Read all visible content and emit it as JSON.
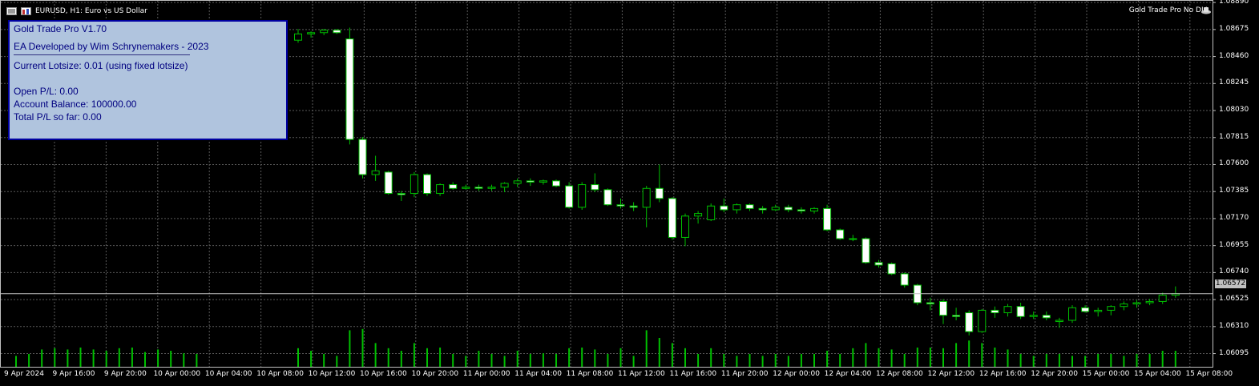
{
  "header": {
    "symbol_title": "EURUSD, H1:  Euro vs US Dollar",
    "ea_name": "Gold Trade Pro No DLL"
  },
  "panel": {
    "line1": "Gold Trade Pro V1.70",
    "line2": "EA Developed by Wim Schrynemakers - 2023",
    "line3": "Current Lotsize: 0.01 (using fixed lotsize)",
    "line4": "Open P/L: 0.00",
    "line5": "Account Balance: 100000.00",
    "line6": "Total P/L so far: 0.00"
  },
  "colors": {
    "background": "#000000",
    "grid": "#5a5a5a",
    "bull_body": "#000000",
    "bear_body": "#ffffff",
    "wick": "#00c000",
    "volume": "#00c000",
    "panel_bg": "#b0c4de",
    "panel_border": "#0000a0",
    "panel_text": "#000080",
    "bid_line": "#c0c0c0"
  },
  "chart_data": {
    "type": "candlestick",
    "symbol": "EURUSD",
    "timeframe": "H1",
    "ylim": [
      1.0599,
      1.0891
    ],
    "price_ticks": [
      "1.08890",
      "1.08675",
      "1.08460",
      "1.08245",
      "1.08030",
      "1.07815",
      "1.07600",
      "1.07385",
      "1.07170",
      "1.06955",
      "1.06740",
      "1.06525",
      "1.06310",
      "1.06095"
    ],
    "time_ticks": [
      "9 Apr 2024",
      "9 Apr 16:00",
      "9 Apr 20:00",
      "10 Apr 00:00",
      "10 Apr 04:00",
      "10 Apr 08:00",
      "10 Apr 12:00",
      "10 Apr 16:00",
      "10 Apr 20:00",
      "11 Apr 00:00",
      "11 Apr 04:00",
      "11 Apr 08:00",
      "11 Apr 12:00",
      "11 Apr 16:00",
      "11 Apr 20:00",
      "12 Apr 00:00",
      "12 Apr 04:00",
      "12 Apr 08:00",
      "12 Apr 12:00",
      "12 Apr 16:00",
      "12 Apr 20:00",
      "15 Apr 00:00",
      "15 Apr 04:00",
      "15 Apr 08:00"
    ],
    "bid_price": "1.06572",
    "grid": true,
    "candles": [
      {
        "o": 1.0859,
        "h": 1.0868,
        "l": 1.0857,
        "c": 1.0864
      },
      {
        "o": 1.0864,
        "h": 1.0866,
        "l": 1.0861,
        "c": 1.0865
      },
      {
        "o": 1.0865,
        "h": 1.0868,
        "l": 1.0863,
        "c": 1.0867
      },
      {
        "o": 1.0867,
        "h": 1.0868,
        "l": 1.0864,
        "c": 1.0865
      },
      {
        "o": 1.086,
        "h": 1.0869,
        "l": 1.0776,
        "c": 1.078
      },
      {
        "o": 1.078,
        "h": 1.0782,
        "l": 1.0749,
        "c": 1.0752
      },
      {
        "o": 1.0752,
        "h": 1.0767,
        "l": 1.0747,
        "c": 1.0755
      },
      {
        "o": 1.0754,
        "h": 1.0755,
        "l": 1.0736,
        "c": 1.0737
      },
      {
        "o": 1.0737,
        "h": 1.0739,
        "l": 1.0731,
        "c": 1.0736
      },
      {
        "o": 1.0737,
        "h": 1.0754,
        "l": 1.0734,
        "c": 1.0752
      },
      {
        "o": 1.0752,
        "h": 1.0753,
        "l": 1.0735,
        "c": 1.0737
      },
      {
        "o": 1.0737,
        "h": 1.0745,
        "l": 1.0735,
        "c": 1.0744
      },
      {
        "o": 1.0744,
        "h": 1.0746,
        "l": 1.074,
        "c": 1.0741
      },
      {
        "o": 1.0741,
        "h": 1.0744,
        "l": 1.074,
        "c": 1.0742
      },
      {
        "o": 1.0742,
        "h": 1.0744,
        "l": 1.0739,
        "c": 1.0741
      },
      {
        "o": 1.0741,
        "h": 1.0744,
        "l": 1.0739,
        "c": 1.0742
      },
      {
        "o": 1.0742,
        "h": 1.0746,
        "l": 1.0738,
        "c": 1.0745
      },
      {
        "o": 1.0745,
        "h": 1.0749,
        "l": 1.0742,
        "c": 1.0747
      },
      {
        "o": 1.0747,
        "h": 1.0749,
        "l": 1.0743,
        "c": 1.0746
      },
      {
        "o": 1.0746,
        "h": 1.0748,
        "l": 1.0744,
        "c": 1.0747
      },
      {
        "o": 1.0747,
        "h": 1.0748,
        "l": 1.0742,
        "c": 1.0743
      },
      {
        "o": 1.0743,
        "h": 1.0746,
        "l": 1.0725,
        "c": 1.0726
      },
      {
        "o": 1.0726,
        "h": 1.0746,
        "l": 1.0724,
        "c": 1.0744
      },
      {
        "o": 1.0744,
        "h": 1.0753,
        "l": 1.0738,
        "c": 1.074
      },
      {
        "o": 1.074,
        "h": 1.0741,
        "l": 1.0727,
        "c": 1.0728
      },
      {
        "o": 1.0728,
        "h": 1.0733,
        "l": 1.0725,
        "c": 1.0727
      },
      {
        "o": 1.0727,
        "h": 1.073,
        "l": 1.0723,
        "c": 1.0726
      },
      {
        "o": 1.0726,
        "h": 1.0743,
        "l": 1.071,
        "c": 1.0741
      },
      {
        "o": 1.0741,
        "h": 1.076,
        "l": 1.073,
        "c": 1.0733
      },
      {
        "o": 1.0733,
        "h": 1.0734,
        "l": 1.07,
        "c": 1.0702
      },
      {
        "o": 1.0702,
        "h": 1.0721,
        "l": 1.0695,
        "c": 1.0719
      },
      {
        "o": 1.0719,
        "h": 1.0723,
        "l": 1.0713,
        "c": 1.0721
      },
      {
        "o": 1.0716,
        "h": 1.0729,
        "l": 1.0715,
        "c": 1.0727
      },
      {
        "o": 1.0727,
        "h": 1.0733,
        "l": 1.0722,
        "c": 1.0724
      },
      {
        "o": 1.0724,
        "h": 1.0729,
        "l": 1.0721,
        "c": 1.0728
      },
      {
        "o": 1.0728,
        "h": 1.0729,
        "l": 1.0723,
        "c": 1.0725
      },
      {
        "o": 1.0725,
        "h": 1.0727,
        "l": 1.0721,
        "c": 1.0724
      },
      {
        "o": 1.0724,
        "h": 1.0728,
        "l": 1.0723,
        "c": 1.0726
      },
      {
        "o": 1.0726,
        "h": 1.0728,
        "l": 1.0722,
        "c": 1.0724
      },
      {
        "o": 1.0724,
        "h": 1.0726,
        "l": 1.0721,
        "c": 1.0723
      },
      {
        "o": 1.0723,
        "h": 1.0726,
        "l": 1.0721,
        "c": 1.0725
      },
      {
        "o": 1.0725,
        "h": 1.0728,
        "l": 1.0707,
        "c": 1.0708
      },
      {
        "o": 1.0708,
        "h": 1.0709,
        "l": 1.07,
        "c": 1.0701
      },
      {
        "o": 1.0701,
        "h": 1.0704,
        "l": 1.0699,
        "c": 1.0701
      },
      {
        "o": 1.0701,
        "h": 1.0702,
        "l": 1.0681,
        "c": 1.0682
      },
      {
        "o": 1.0682,
        "h": 1.0684,
        "l": 1.0678,
        "c": 1.068
      },
      {
        "o": 1.0681,
        "h": 1.0682,
        "l": 1.0672,
        "c": 1.0673
      },
      {
        "o": 1.0673,
        "h": 1.0674,
        "l": 1.0662,
        "c": 1.0664
      },
      {
        "o": 1.0664,
        "h": 1.0665,
        "l": 1.0648,
        "c": 1.065
      },
      {
        "o": 1.065,
        "h": 1.0654,
        "l": 1.0644,
        "c": 1.0649
      },
      {
        "o": 1.0651,
        "h": 1.0653,
        "l": 1.0633,
        "c": 1.064
      },
      {
        "o": 1.064,
        "h": 1.0646,
        "l": 1.0636,
        "c": 1.0639
      },
      {
        "o": 1.0642,
        "h": 1.0644,
        "l": 1.0624,
        "c": 1.0627
      },
      {
        "o": 1.0627,
        "h": 1.0645,
        "l": 1.0626,
        "c": 1.0644
      },
      {
        "o": 1.0644,
        "h": 1.0647,
        "l": 1.0638,
        "c": 1.0642
      },
      {
        "o": 1.0642,
        "h": 1.0649,
        "l": 1.0639,
        "c": 1.0647
      },
      {
        "o": 1.0647,
        "h": 1.065,
        "l": 1.0637,
        "c": 1.0639
      },
      {
        "o": 1.0639,
        "h": 1.0643,
        "l": 1.0637,
        "c": 1.064
      },
      {
        "o": 1.064,
        "h": 1.0643,
        "l": 1.0636,
        "c": 1.0638
      },
      {
        "o": 1.0635,
        "h": 1.0638,
        "l": 1.063,
        "c": 1.0636
      },
      {
        "o": 1.0636,
        "h": 1.0648,
        "l": 1.0634,
        "c": 1.0646
      },
      {
        "o": 1.0646,
        "h": 1.0648,
        "l": 1.0642,
        "c": 1.0643
      },
      {
        "o": 1.0643,
        "h": 1.0646,
        "l": 1.0639,
        "c": 1.0644
      },
      {
        "o": 1.0644,
        "h": 1.0648,
        "l": 1.064,
        "c": 1.0647
      },
      {
        "o": 1.0647,
        "h": 1.0651,
        "l": 1.0644,
        "c": 1.0649
      },
      {
        "o": 1.0649,
        "h": 1.0652,
        "l": 1.0646,
        "c": 1.065
      },
      {
        "o": 1.065,
        "h": 1.0653,
        "l": 1.0648,
        "c": 1.0651
      },
      {
        "o": 1.0651,
        "h": 1.0658,
        "l": 1.0649,
        "c": 1.0656
      },
      {
        "o": 1.0656,
        "h": 1.0663,
        "l": 1.0654,
        "c": 1.06572
      }
    ],
    "volumes_left": [
      0.17,
      0.2,
      0.27,
      0.29,
      0.27,
      0.3,
      0.27,
      0.25,
      0.29,
      0.3,
      0.23,
      0.27,
      0.25,
      0.21,
      0.2
    ],
    "volumes": [
      0.29,
      0.25,
      0.2,
      0.17,
      0.57,
      0.59,
      0.37,
      0.29,
      0.25,
      0.37,
      0.29,
      0.3,
      0.2,
      0.17,
      0.25,
      0.2,
      0.17,
      0.25,
      0.2,
      0.21,
      0.2,
      0.29,
      0.3,
      0.27,
      0.2,
      0.29,
      0.17,
      0.57,
      0.45,
      0.37,
      0.29,
      0.2,
      0.29,
      0.2,
      0.17,
      0.2,
      0.17,
      0.2,
      0.17,
      0.2,
      0.2,
      0.25,
      0.2,
      0.29,
      0.37,
      0.29,
      0.27,
      0.2,
      0.3,
      0.3,
      0.29,
      0.37,
      0.41,
      0.37,
      0.3,
      0.27,
      0.2,
      0.17,
      0.2,
      0.2,
      0.17,
      0.17,
      0.2,
      0.2,
      0.17,
      0.2,
      0.2,
      0.25,
      0.25
    ]
  }
}
